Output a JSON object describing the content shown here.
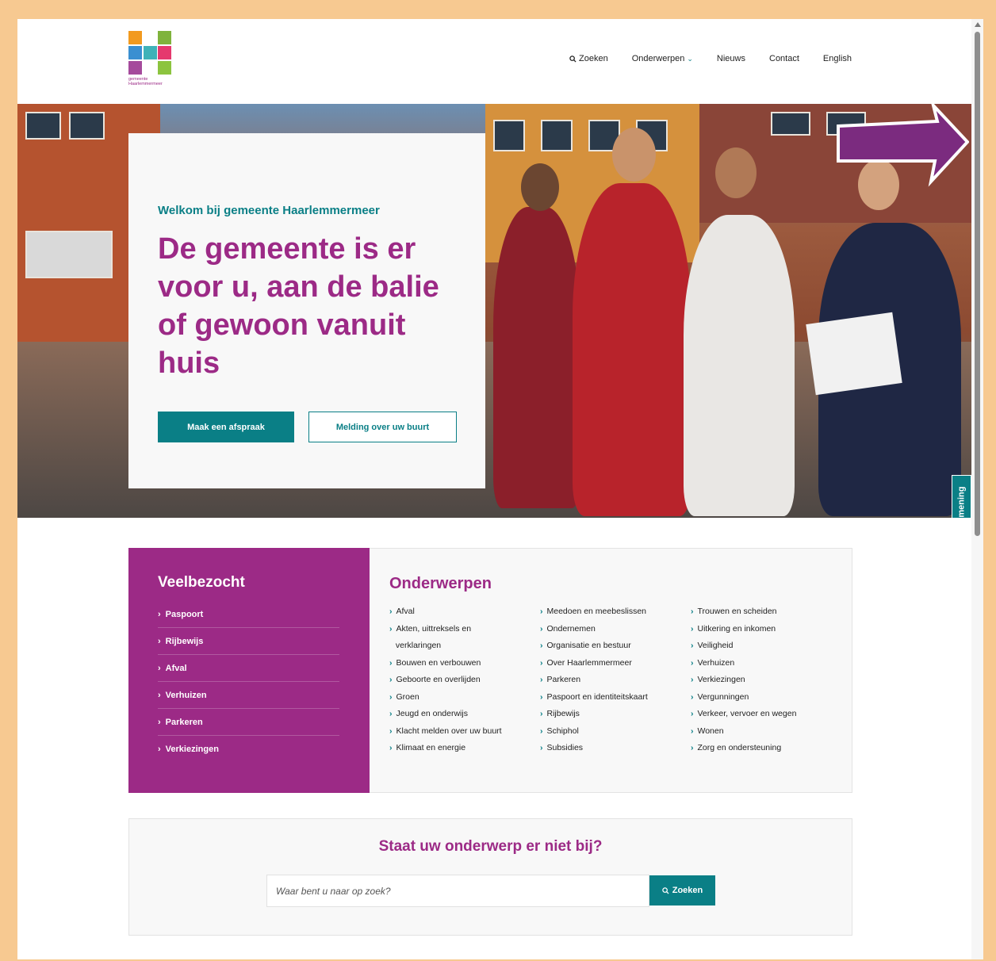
{
  "brand": {
    "logo_caption_line1": "gemeente",
    "logo_caption_line2": "Haarlemmermeer",
    "accent_purple": "#9c2a86",
    "accent_teal": "#0a7f86"
  },
  "nav": {
    "search_label": "Zoeken",
    "topics_label": "Onderwerpen",
    "news_label": "Nieuws",
    "contact_label": "Contact",
    "english_label": "English"
  },
  "hero": {
    "welcome": "Welkom bij gemeente Haarlemmermeer",
    "title": "De gemeente is er voor u, aan de balie of gewoon vanuit huis",
    "primary_button": "Maak een afspraak",
    "secondary_button": "Melding over uw buurt",
    "feedback_tab": "Geef uw mening"
  },
  "popular": {
    "title": "Veelbezocht",
    "items": [
      "Paspoort",
      "Rijbewijs",
      "Afval",
      "Verhuizen",
      "Parkeren",
      "Verkiezingen"
    ]
  },
  "subjects": {
    "title": "Onderwerpen",
    "col1": [
      "Afval",
      "Akten, uittreksels en",
      "verklaringen",
      "Bouwen en verbouwen",
      "Geboorte en overlijden",
      "Groen",
      "Jeugd en onderwijs",
      "Klacht melden over uw buurt",
      "Klimaat en energie"
    ],
    "col2": [
      "Meedoen en meebeslissen",
      "Ondernemen",
      "Organisatie en bestuur",
      "Over Haarlemmermeer",
      "Parkeren",
      "Paspoort en identiteitskaart",
      "Rijbewijs",
      "Schiphol",
      "Subsidies"
    ],
    "col3": [
      "Trouwen en scheiden",
      "Uitkering en inkomen",
      "Veiligheid",
      "Verhuizen",
      "Verkiezingen",
      "Vergunningen",
      "Verkeer, vervoer en wegen",
      "Wonen",
      "Zorg en ondersteuning"
    ]
  },
  "search": {
    "title": "Staat uw onderwerp er niet bij?",
    "placeholder": "Waar bent u naar op zoek?",
    "button": "Zoeken"
  }
}
